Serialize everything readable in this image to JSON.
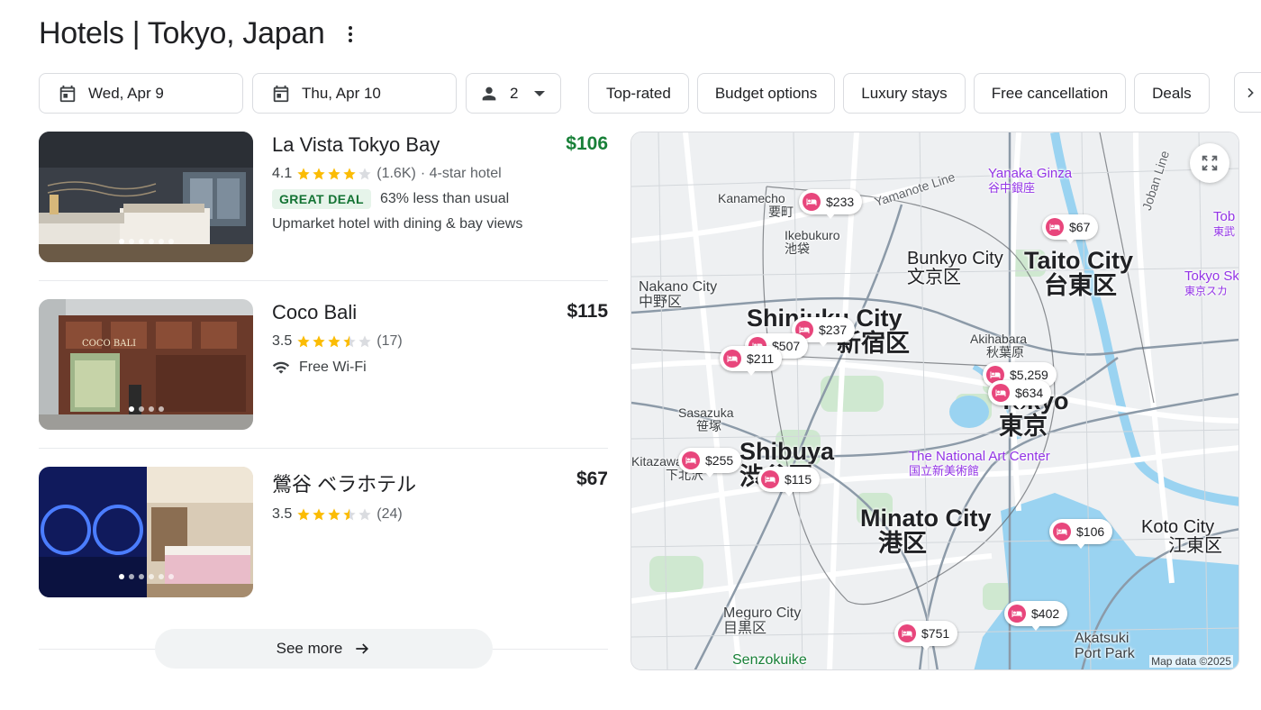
{
  "header": {
    "title": "Hotels | Tokyo, Japan"
  },
  "filters": {
    "check_in": "Wed, Apr 9",
    "check_out": "Thu, Apr 10",
    "guests": "2",
    "chips": [
      "Top-rated",
      "Budget options",
      "Luxury stays",
      "Free cancellation",
      "Deals"
    ]
  },
  "hotels": [
    {
      "name": "La Vista Tokyo Bay",
      "price": "$106",
      "rating": "4.1",
      "stars": 4.1,
      "reviews": "(1.6K)",
      "class": "· 4-star hotel",
      "badge": "GREAT DEAL",
      "deal_text": "63% less than usual",
      "description": "Upmarket hotel with dining & bay views"
    },
    {
      "name": "Coco Bali",
      "price": "$115",
      "rating": "3.5",
      "stars": 3.5,
      "reviews": "(17)",
      "amenity": "Free Wi-Fi"
    },
    {
      "name": "鶯谷 ベラホテル",
      "price": "$67",
      "rating": "3.5",
      "stars": 3.5,
      "reviews": "(24)"
    }
  ],
  "see_more": "See more",
  "map": {
    "attribution": "Map data ©2025",
    "labels": {
      "kanamecho": "Kanamecho",
      "kanamecho_jp": "要町",
      "ikebukuro": "Ikebukuro",
      "ikebukuro_jp": "池袋",
      "yanaka": "Yanaka Ginza",
      "yanaka_jp": "谷中銀座",
      "bunkyo": "Bunkyo City",
      "bunkyo_jp": "文京区",
      "taito": "Taito City",
      "taito_jp": "台東区",
      "nakano": "Nakano City",
      "nakano_jp": "中野区",
      "shinjuku": "Shinjuku City",
      "shinjuku_jp": "新宿区",
      "akihabara": "Akihabara",
      "akihabara_jp": "秋葉原",
      "tokyo": "Tokyo",
      "tokyo_jp": "東京",
      "sasazuka": "Sasazuka",
      "sasazuka_jp": "笹塚",
      "shibuya": "Shibuya",
      "shibuya_jp": "渋谷区",
      "national_art": "The National Art Center",
      "national_art_jp": "国立新美術館",
      "kitazawa": "Kitazawa",
      "kitazawa_jp": "下北沢",
      "minato": "Minato City",
      "minato_jp": "港区",
      "koto": "Koto City",
      "koto_jp": "江東区",
      "meguro": "Meguro City",
      "meguro_jp": "目黒区",
      "senzokuike": "Senzokuike",
      "akatsuki": "Akatsuki",
      "port_park": "Port Park",
      "tokyo_skytree": "Tokyo Sky",
      "tokyo_skytree_jp": "東京スカ",
      "tob": "Tob",
      "tob_jp": "東武",
      "yamanote": "Yamanote Line",
      "joban": "Joban Line"
    },
    "pins": [
      "$233",
      "$67",
      "$237",
      "$507",
      "$211",
      "$5,259",
      "$634",
      "$255",
      "$115",
      "$106",
      "$402",
      "$751"
    ]
  }
}
